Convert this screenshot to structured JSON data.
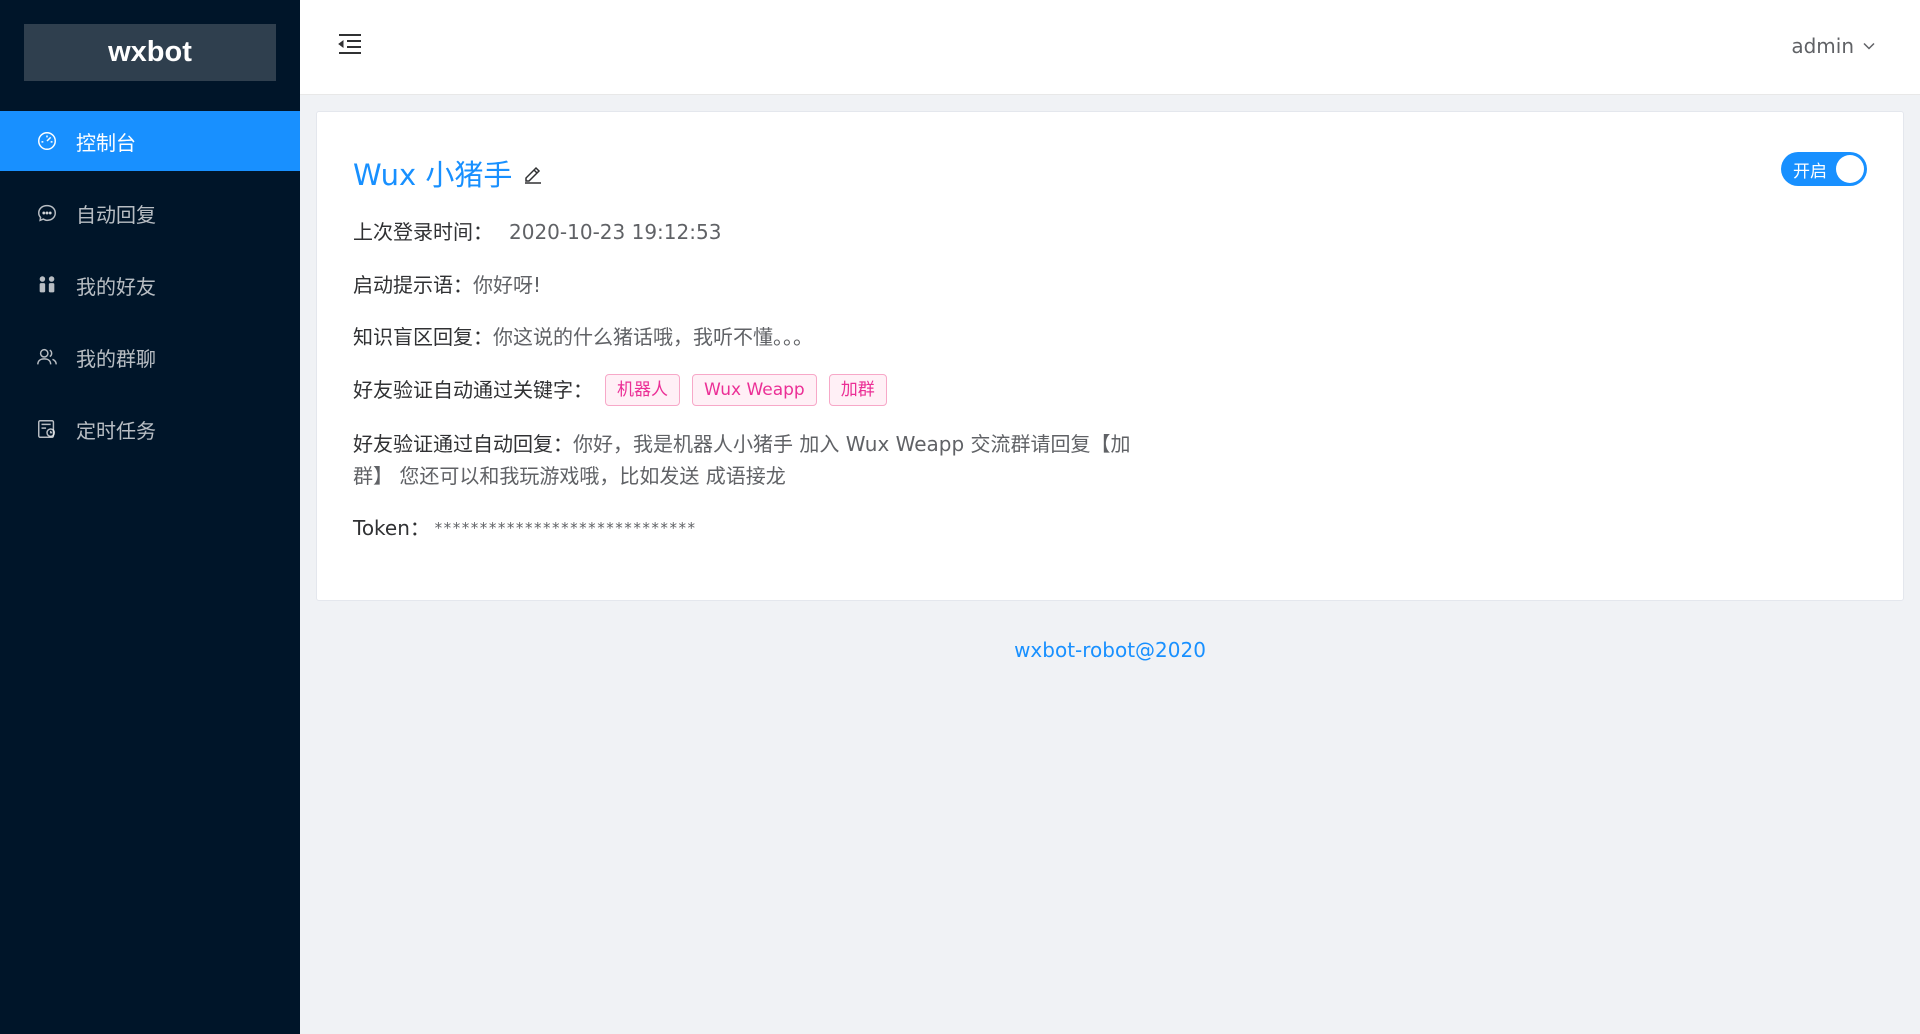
{
  "app": {
    "logo": "wxbot"
  },
  "sidebar": {
    "items": [
      {
        "label": "控制台",
        "icon": "dashboard-icon",
        "active": true
      },
      {
        "label": "自动回复",
        "icon": "message-icon",
        "active": false
      },
      {
        "label": "我的好友",
        "icon": "friends-icon",
        "active": false
      },
      {
        "label": "我的群聊",
        "icon": "group-icon",
        "active": false
      },
      {
        "label": "定时任务",
        "icon": "schedule-icon",
        "active": false
      }
    ]
  },
  "header": {
    "user": "admin"
  },
  "card": {
    "bot_name": "Wux 小猪手",
    "toggle_label": "开启",
    "toggle_on": true,
    "last_login_label": "上次登录时间：",
    "last_login_value": "2020-10-23 19:12:53",
    "greeting_label": "启动提示语：",
    "greeting_value": "你好呀!",
    "unknown_label": "知识盲区回复：",
    "unknown_value": "你这说的什么猪话哦，我听不懂。。。",
    "keywords_label": "好友验证自动通过关键字：",
    "keywords": [
      "机器人",
      "Wux Weapp",
      "加群"
    ],
    "autoreply_label": "好友验证通过自动回复：",
    "autoreply_value": "你好，我是机器人小猪手 加入 Wux Weapp 交流群请回复【加群】 您还可以和我玩游戏哦，比如发送 成语接龙",
    "token_label": "Token：",
    "token_value": "*****************************"
  },
  "footer": {
    "text": "wxbot-robot@2020"
  },
  "colors": {
    "primary": "#1890ff",
    "sidebar": "#001529",
    "tag": "#eb2f96"
  }
}
